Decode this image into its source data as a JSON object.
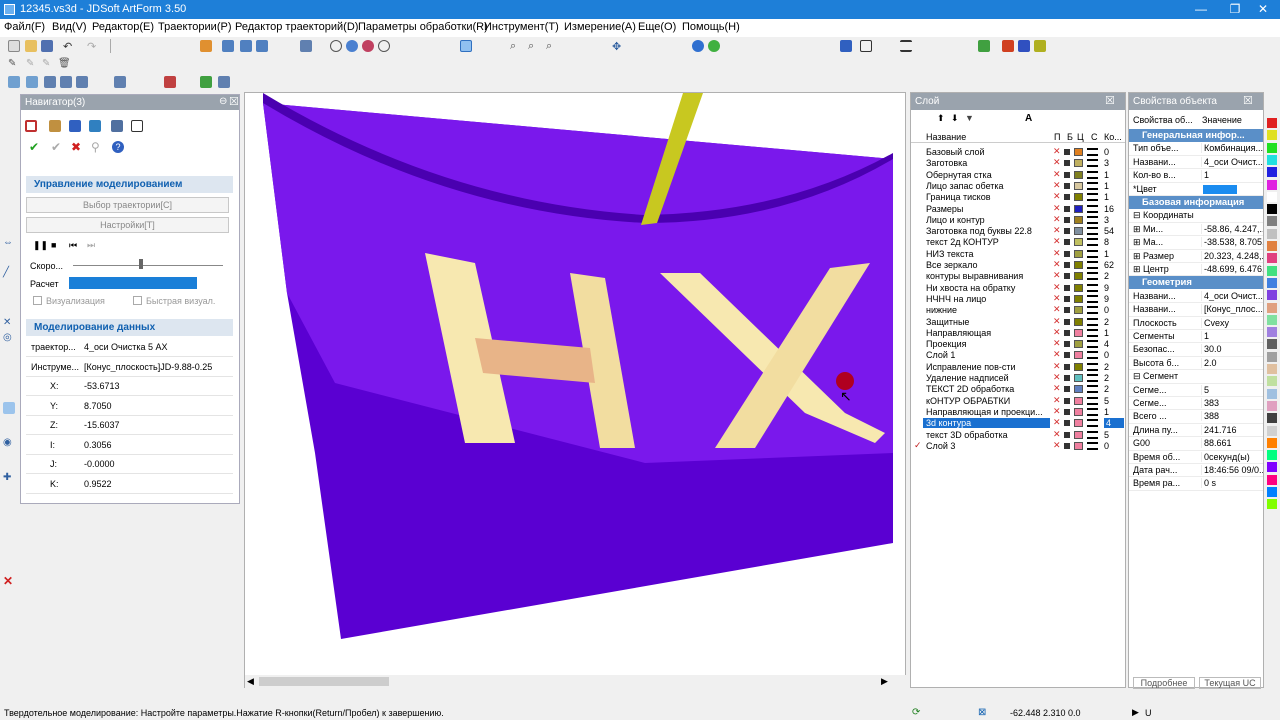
{
  "window": {
    "title": "12345.vs3d - JDSoft ArtForm 3.50",
    "min": "—",
    "max": "❐",
    "close": "✕"
  },
  "menu": [
    "Файл(F)",
    "Вид(V)",
    "Редактор(E)",
    "Траектории(P)",
    "Редактор траекторий(D)",
    "Параметры обработки(R)",
    "Инструмент(T)",
    "Измерение(A)",
    "Еще(O)",
    "Помощь(H)"
  ],
  "navigator": {
    "title": "Навигатор(3)",
    "section_modeling": "Управление моделированием",
    "btn_select_path": "Выбор траектории[C]",
    "btn_settings": "Настройки[T]",
    "speed_label": "Скоро...",
    "calc_label": "Расчет",
    "calc_progress": 1.0,
    "chk_visual": "Визуализация",
    "chk_fast": "Быстрая визуал.",
    "section_data": "Моделирование данных",
    "rows": [
      {
        "k": "траектор...",
        "v": "4_оси Очистка 5 AX"
      },
      {
        "k": "Инструме...",
        "v": "[Конус_плоскость]JD-9.88-0.25"
      },
      {
        "k": "X:",
        "v": "-53.6713"
      },
      {
        "k": "Y:",
        "v": "8.7050"
      },
      {
        "k": "Z:",
        "v": "-15.6037"
      },
      {
        "k": "I:",
        "v": "0.3056"
      },
      {
        "k": "J:",
        "v": "-0.0000"
      },
      {
        "k": "K:",
        "v": "0.9522"
      }
    ]
  },
  "layers": {
    "title": "Слой",
    "headers": [
      "Название",
      "П",
      "Б",
      "Ц",
      "С",
      "Ко..."
    ],
    "items": [
      {
        "name": "Базовый слой",
        "color": "#e08020",
        "count": "0"
      },
      {
        "name": "Заготовка",
        "color": "#c0b060",
        "count": "3"
      },
      {
        "name": "Обернутая стка",
        "color": "#808020",
        "count": "1"
      },
      {
        "name": "Лицо запас обетка",
        "color": "#d8c8a0",
        "count": "1"
      },
      {
        "name": "Граница тисков",
        "color": "#808000",
        "count": "1"
      },
      {
        "name": "Размеры",
        "color": "#2020c0",
        "count": "16"
      },
      {
        "name": "Лицо и контур",
        "color": "#a08020",
        "count": "3"
      },
      {
        "name": "Заготовка под буквы 22.8",
        "color": "#8090a0",
        "count": "54"
      },
      {
        "name": "текст 2д КОНТУР",
        "color": "#c0c060",
        "count": "8"
      },
      {
        "name": "НИЗ текста",
        "color": "#a0a040",
        "count": "1"
      },
      {
        "name": "Все зеркало",
        "color": "#808000",
        "count": "62"
      },
      {
        "name": "контуры выравнивания",
        "color": "#808000",
        "count": "2"
      },
      {
        "name": "Ни хвоста на обратку",
        "color": "#808000",
        "count": "9"
      },
      {
        "name": "НЧНЧ на лицо",
        "color": "#808000",
        "count": "9"
      },
      {
        "name": "нижние",
        "color": "#a0a040",
        "count": "0"
      },
      {
        "name": "Защитные",
        "color": "#808000",
        "count": "2"
      },
      {
        "name": "Направляющая",
        "color": "#f080a0",
        "count": "1"
      },
      {
        "name": "Проекция",
        "color": "#a0a040",
        "count": "4"
      },
      {
        "name": "Слой 1",
        "color": "#f080a0",
        "count": "0"
      },
      {
        "name": "Исправление пов-сти",
        "color": "#808000",
        "count": "2"
      },
      {
        "name": "Удаление надписей",
        "color": "#60c0c0",
        "count": "2"
      },
      {
        "name": "ТЕКСТ 2D обработка",
        "color": "#6080c0",
        "count": "2"
      },
      {
        "name": "кОНТУР ОБРАБТКИ",
        "color": "#f080a0",
        "count": "5"
      },
      {
        "name": "Направляющая и проекци...",
        "color": "#f080a0",
        "count": "1"
      },
      {
        "name": "3d контура",
        "color": "#f080a0",
        "count": "4"
      },
      {
        "name": "текст 3D обработка",
        "color": "#f080a0",
        "count": "5"
      },
      {
        "name": "Слой 3",
        "color": "#f080a0",
        "count": "0"
      }
    ]
  },
  "props": {
    "title": "Свойства объекта",
    "col1": "Свойства об...",
    "col2": "Значение",
    "groups": [
      {
        "title": "Генеральная инфор...",
        "rows": [
          {
            "k": "Тип объе...",
            "v": "Комбинация..."
          },
          {
            "k": "Названи...",
            "v": "4_оси Очист..."
          },
          {
            "k": "Кол-во в...",
            "v": "1"
          },
          {
            "k": "*Цвет",
            "v": ""
          }
        ]
      },
      {
        "title": "Базовая информация",
        "rows": [
          {
            "k": "⊟ Координаты",
            "v": ""
          },
          {
            "k": "⊞ Ми...",
            "v": "-58.86, 4.247,..."
          },
          {
            "k": "⊞ Ма...",
            "v": "-38.538, 8.705,..."
          },
          {
            "k": "⊞ Размер",
            "v": "20.323, 4.248,..."
          },
          {
            "k": "⊞ Центр",
            "v": "-48.699, 6.476,..."
          }
        ]
      },
      {
        "title": "Геометрия",
        "rows": [
          {
            "k": "Названи...",
            "v": "4_оси Очист..."
          },
          {
            "k": "Названи...",
            "v": "[Конус_плос..."
          },
          {
            "k": "Плоскость",
            "v": "Cvexy"
          },
          {
            "k": "Сегменты",
            "v": "1"
          },
          {
            "k": "Безопас...",
            "v": "30.0"
          },
          {
            "k": "Высота б...",
            "v": "2.0"
          },
          {
            "k": "⊟ Сегмент",
            "v": ""
          },
          {
            "k": "Сегме...",
            "v": "5"
          },
          {
            "k": "Сегме...",
            "v": "383"
          },
          {
            "k": "Всего ...",
            "v": "388"
          },
          {
            "k": "Длина пу...",
            "v": "241.716"
          },
          {
            "k": "G00",
            "v": "88.661"
          },
          {
            "k": "Время об...",
            "v": "0секунд(ы)"
          },
          {
            "k": "Дата рач...",
            "v": "18:46:56 09/0..."
          },
          {
            "k": "Время ра...",
            "v": "0 s"
          }
        ]
      }
    ],
    "btn_more": "Подробнее",
    "btn_current": "Текущая UC"
  },
  "status": {
    "text": "Твердотельное моделирование: Настройте параметры.Нажатие R-кнопки(Return/Пробел) к завершению.",
    "coords": "-62.448 2.310 0.0",
    "unit": "U"
  },
  "viewport": {
    "letters": "НХ"
  },
  "colors": {
    "accent": "#1e7fd8",
    "model": "#6a00d8",
    "letters": "#f7e8b0"
  }
}
